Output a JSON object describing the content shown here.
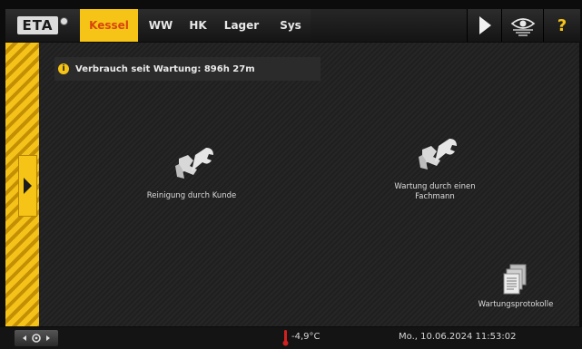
{
  "header": {
    "logo_text": "ETA",
    "tabs": [
      {
        "label": "Kessel",
        "active": true
      },
      {
        "label": "WW",
        "active": false
      },
      {
        "label": "HK",
        "active": false
      },
      {
        "label": "Lager",
        "active": false
      },
      {
        "label": "Sys",
        "active": false
      }
    ],
    "help_label": "?"
  },
  "info": {
    "text": "Verbrauch seit Wartung: 896h 27m"
  },
  "actions": {
    "customer_cleaning": "Reinigung durch Kunde",
    "expert_service": "Wartung durch einen\nFachmann",
    "service_logs": "Wartungsprotokolle"
  },
  "status": {
    "temperature": "-4,9°C",
    "datetime": "Mo., 10.06.2024 11:53:02"
  },
  "icons": {
    "tool": "wrench-hand-icon",
    "docs": "documents-icon",
    "view": "eye-view-icon",
    "thermometer": "thermometer-icon"
  },
  "colors": {
    "accent_yellow": "#f6c417",
    "active_tab_text": "#d8460d",
    "thermometer_red": "#d32020"
  }
}
